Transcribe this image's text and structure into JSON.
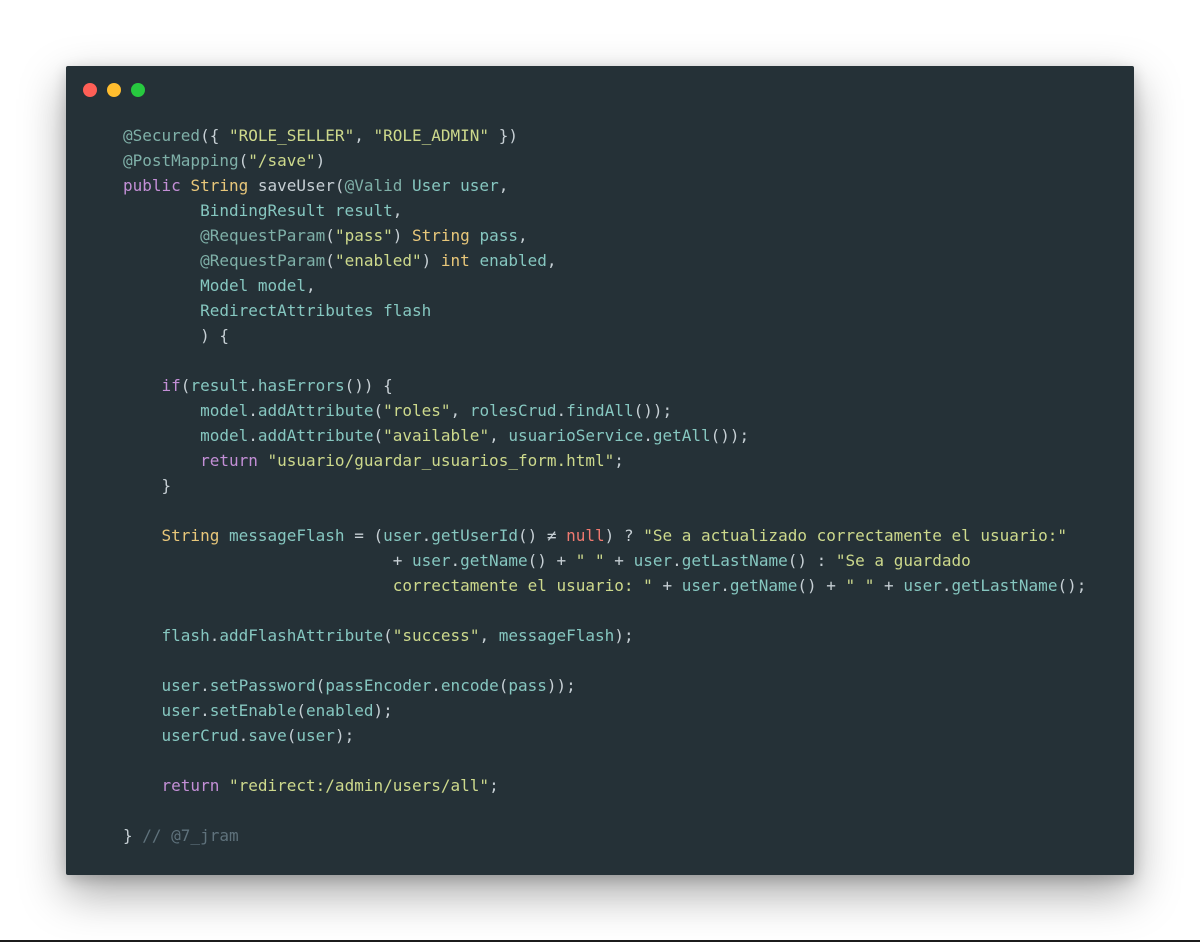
{
  "window": {
    "controls": [
      {
        "name": "close-dot",
        "color": "#ff5f56"
      },
      {
        "name": "minimize-dot",
        "color": "#ffbd2e"
      },
      {
        "name": "maximize-dot",
        "color": "#27c93f"
      }
    ],
    "background": "#253137"
  },
  "code": {
    "language": "java",
    "lines": [
      [
        {
          "t": "ann",
          "v": "@Secured"
        },
        {
          "t": "plain",
          "v": "({ "
        },
        {
          "t": "str",
          "v": "\"ROLE_SELLER\""
        },
        {
          "t": "plain",
          "v": ", "
        },
        {
          "t": "str",
          "v": "\"ROLE_ADMIN\""
        },
        {
          "t": "plain",
          "v": " })"
        }
      ],
      [
        {
          "t": "ann",
          "v": "@PostMapping"
        },
        {
          "t": "plain",
          "v": "("
        },
        {
          "t": "str",
          "v": "\"/save\""
        },
        {
          "t": "plain",
          "v": ")"
        }
      ],
      [
        {
          "t": "kw",
          "v": "public"
        },
        {
          "t": "plain",
          "v": " "
        },
        {
          "t": "type",
          "v": "String"
        },
        {
          "t": "plain",
          "v": " saveUser("
        },
        {
          "t": "ann",
          "v": "@Valid"
        },
        {
          "t": "plain",
          "v": " "
        },
        {
          "t": "var",
          "v": "User user"
        },
        {
          "t": "plain",
          "v": ","
        }
      ],
      [
        {
          "t": "plain",
          "v": "        "
        },
        {
          "t": "var",
          "v": "BindingResult result"
        },
        {
          "t": "plain",
          "v": ","
        }
      ],
      [
        {
          "t": "plain",
          "v": "        "
        },
        {
          "t": "ann",
          "v": "@RequestParam"
        },
        {
          "t": "plain",
          "v": "("
        },
        {
          "t": "str",
          "v": "\"pass\""
        },
        {
          "t": "plain",
          "v": ") "
        },
        {
          "t": "type",
          "v": "String"
        },
        {
          "t": "plain",
          "v": " "
        },
        {
          "t": "var",
          "v": "pass"
        },
        {
          "t": "plain",
          "v": ","
        }
      ],
      [
        {
          "t": "plain",
          "v": "        "
        },
        {
          "t": "ann",
          "v": "@RequestParam"
        },
        {
          "t": "plain",
          "v": "("
        },
        {
          "t": "str",
          "v": "\"enabled\""
        },
        {
          "t": "plain",
          "v": ") "
        },
        {
          "t": "type",
          "v": "int"
        },
        {
          "t": "plain",
          "v": " "
        },
        {
          "t": "var",
          "v": "enabled"
        },
        {
          "t": "plain",
          "v": ","
        }
      ],
      [
        {
          "t": "plain",
          "v": "        "
        },
        {
          "t": "var",
          "v": "Model model"
        },
        {
          "t": "plain",
          "v": ","
        }
      ],
      [
        {
          "t": "plain",
          "v": "        "
        },
        {
          "t": "var",
          "v": "RedirectAttributes flash"
        }
      ],
      [
        {
          "t": "plain",
          "v": "        ) {"
        }
      ],
      [],
      [
        {
          "t": "plain",
          "v": "    "
        },
        {
          "t": "kw",
          "v": "if"
        },
        {
          "t": "plain",
          "v": "("
        },
        {
          "t": "var",
          "v": "result"
        },
        {
          "t": "plain",
          "v": "."
        },
        {
          "t": "var",
          "v": "hasErrors"
        },
        {
          "t": "plain",
          "v": "()) {"
        }
      ],
      [
        {
          "t": "plain",
          "v": "        "
        },
        {
          "t": "var",
          "v": "model"
        },
        {
          "t": "plain",
          "v": "."
        },
        {
          "t": "var",
          "v": "addAttribute"
        },
        {
          "t": "plain",
          "v": "("
        },
        {
          "t": "str",
          "v": "\"roles\""
        },
        {
          "t": "plain",
          "v": ", "
        },
        {
          "t": "var",
          "v": "rolesCrud"
        },
        {
          "t": "plain",
          "v": "."
        },
        {
          "t": "var",
          "v": "findAll"
        },
        {
          "t": "plain",
          "v": "());"
        }
      ],
      [
        {
          "t": "plain",
          "v": "        "
        },
        {
          "t": "var",
          "v": "model"
        },
        {
          "t": "plain",
          "v": "."
        },
        {
          "t": "var",
          "v": "addAttribute"
        },
        {
          "t": "plain",
          "v": "("
        },
        {
          "t": "str",
          "v": "\"available\""
        },
        {
          "t": "plain",
          "v": ", "
        },
        {
          "t": "var",
          "v": "usuarioService"
        },
        {
          "t": "plain",
          "v": "."
        },
        {
          "t": "var",
          "v": "getAll"
        },
        {
          "t": "plain",
          "v": "());"
        }
      ],
      [
        {
          "t": "plain",
          "v": "        "
        },
        {
          "t": "kw",
          "v": "return"
        },
        {
          "t": "plain",
          "v": " "
        },
        {
          "t": "str",
          "v": "\"usuario/guardar_usuarios_form.html\""
        },
        {
          "t": "plain",
          "v": ";"
        }
      ],
      [
        {
          "t": "plain",
          "v": "    }"
        }
      ],
      [],
      [
        {
          "t": "plain",
          "v": "    "
        },
        {
          "t": "type",
          "v": "String"
        },
        {
          "t": "plain",
          "v": " "
        },
        {
          "t": "var",
          "v": "messageFlash"
        },
        {
          "t": "plain",
          "v": " = ("
        },
        {
          "t": "var",
          "v": "user"
        },
        {
          "t": "plain",
          "v": "."
        },
        {
          "t": "var",
          "v": "getUserId"
        },
        {
          "t": "plain",
          "v": "() ≠ "
        },
        {
          "t": "null",
          "v": "null"
        },
        {
          "t": "plain",
          "v": ") ? "
        },
        {
          "t": "str",
          "v": "\"Se a actualizado correctamente el usuario:\""
        }
      ],
      [
        {
          "t": "plain",
          "v": "                            + "
        },
        {
          "t": "var",
          "v": "user"
        },
        {
          "t": "plain",
          "v": "."
        },
        {
          "t": "var",
          "v": "getName"
        },
        {
          "t": "plain",
          "v": "() + "
        },
        {
          "t": "str",
          "v": "\" \""
        },
        {
          "t": "plain",
          "v": " + "
        },
        {
          "t": "var",
          "v": "user"
        },
        {
          "t": "plain",
          "v": "."
        },
        {
          "t": "var",
          "v": "getLastName"
        },
        {
          "t": "plain",
          "v": "() : "
        },
        {
          "t": "str",
          "v": "\"Se a guardado"
        }
      ],
      [
        {
          "t": "plain",
          "v": "                            "
        },
        {
          "t": "str",
          "v": "correctamente el usuario: \""
        },
        {
          "t": "plain",
          "v": " + "
        },
        {
          "t": "var",
          "v": "user"
        },
        {
          "t": "plain",
          "v": "."
        },
        {
          "t": "var",
          "v": "getName"
        },
        {
          "t": "plain",
          "v": "() + "
        },
        {
          "t": "str",
          "v": "\" \""
        },
        {
          "t": "plain",
          "v": " + "
        },
        {
          "t": "var",
          "v": "user"
        },
        {
          "t": "plain",
          "v": "."
        },
        {
          "t": "var",
          "v": "getLastName"
        },
        {
          "t": "plain",
          "v": "();"
        }
      ],
      [],
      [
        {
          "t": "plain",
          "v": "    "
        },
        {
          "t": "var",
          "v": "flash"
        },
        {
          "t": "plain",
          "v": "."
        },
        {
          "t": "var",
          "v": "addFlashAttribute"
        },
        {
          "t": "plain",
          "v": "("
        },
        {
          "t": "str",
          "v": "\"success\""
        },
        {
          "t": "plain",
          "v": ", "
        },
        {
          "t": "var",
          "v": "messageFlash"
        },
        {
          "t": "plain",
          "v": ");"
        }
      ],
      [],
      [
        {
          "t": "plain",
          "v": "    "
        },
        {
          "t": "var",
          "v": "user"
        },
        {
          "t": "plain",
          "v": "."
        },
        {
          "t": "var",
          "v": "setPassword"
        },
        {
          "t": "plain",
          "v": "("
        },
        {
          "t": "var",
          "v": "passEncoder"
        },
        {
          "t": "plain",
          "v": "."
        },
        {
          "t": "var",
          "v": "encode"
        },
        {
          "t": "plain",
          "v": "("
        },
        {
          "t": "var",
          "v": "pass"
        },
        {
          "t": "plain",
          "v": "));"
        }
      ],
      [
        {
          "t": "plain",
          "v": "    "
        },
        {
          "t": "var",
          "v": "user"
        },
        {
          "t": "plain",
          "v": "."
        },
        {
          "t": "var",
          "v": "setEnable"
        },
        {
          "t": "plain",
          "v": "("
        },
        {
          "t": "var",
          "v": "enabled"
        },
        {
          "t": "plain",
          "v": ");"
        }
      ],
      [
        {
          "t": "plain",
          "v": "    "
        },
        {
          "t": "var",
          "v": "userCrud"
        },
        {
          "t": "plain",
          "v": "."
        },
        {
          "t": "var",
          "v": "save"
        },
        {
          "t": "plain",
          "v": "("
        },
        {
          "t": "var",
          "v": "user"
        },
        {
          "t": "plain",
          "v": ");"
        }
      ],
      [],
      [
        {
          "t": "plain",
          "v": "    "
        },
        {
          "t": "kw",
          "v": "return"
        },
        {
          "t": "plain",
          "v": " "
        },
        {
          "t": "str",
          "v": "\"redirect:/admin/users/all\""
        },
        {
          "t": "plain",
          "v": ";"
        }
      ],
      [],
      [
        {
          "t": "plain",
          "v": "} "
        },
        {
          "t": "com",
          "v": "// @7_jram"
        }
      ]
    ]
  }
}
